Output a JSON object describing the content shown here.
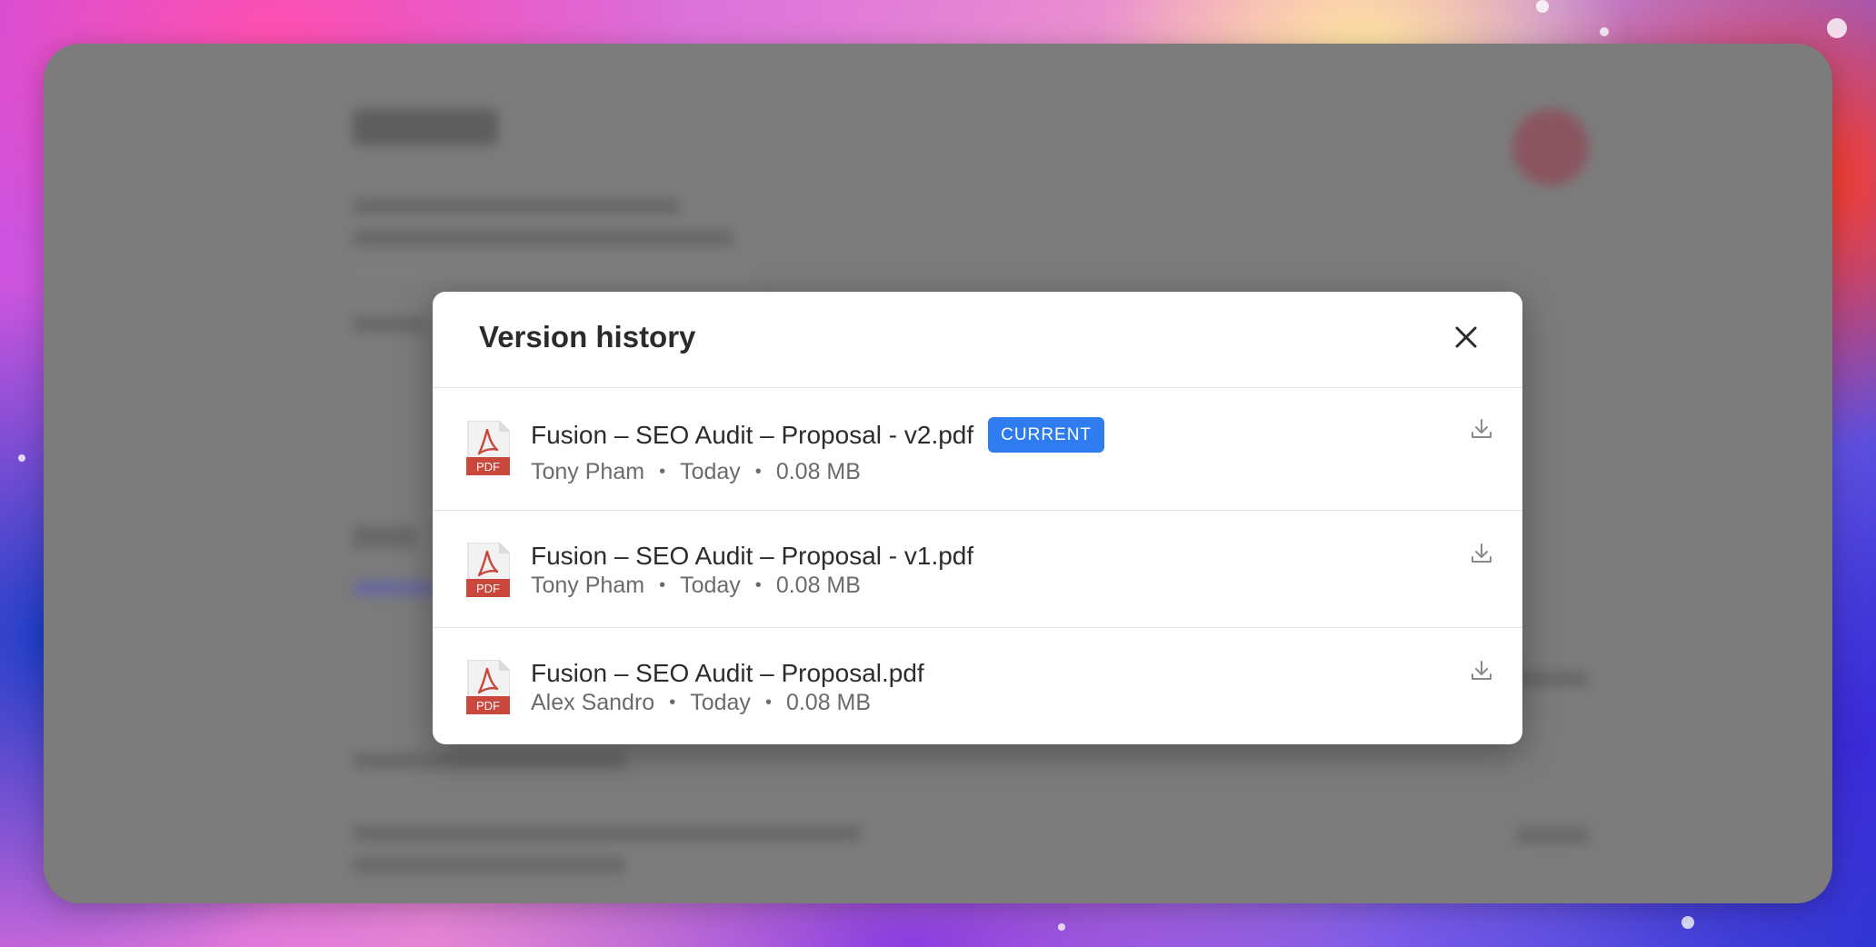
{
  "modal": {
    "title": "Version history",
    "close_icon": "close-icon"
  },
  "versions": [
    {
      "file_name": "Fusion – SEO Audit – Proposal - v2.pdf",
      "badge": "CURRENT",
      "author": "Tony Pham",
      "date": "Today",
      "size": "0.08 MB",
      "icon_label": "PDF",
      "icon": "pdf-file-icon",
      "action_icon": "download-icon"
    },
    {
      "file_name": "Fusion – SEO Audit – Proposal - v1.pdf",
      "badge": "",
      "author": "Tony Pham",
      "date": "Today",
      "size": "0.08 MB",
      "icon_label": "PDF",
      "icon": "pdf-file-icon",
      "action_icon": "download-icon"
    },
    {
      "file_name": "Fusion – SEO Audit – Proposal.pdf",
      "badge": "",
      "author": "Alex Sandro",
      "date": "Today",
      "size": "0.08 MB",
      "icon_label": "PDF",
      "icon": "pdf-file-icon",
      "action_icon": "download-icon"
    }
  ],
  "separator": "•",
  "colors": {
    "badge": "#2f7cf0",
    "pdf_red": "#c9473b",
    "overlay": "#7c7c7c"
  }
}
